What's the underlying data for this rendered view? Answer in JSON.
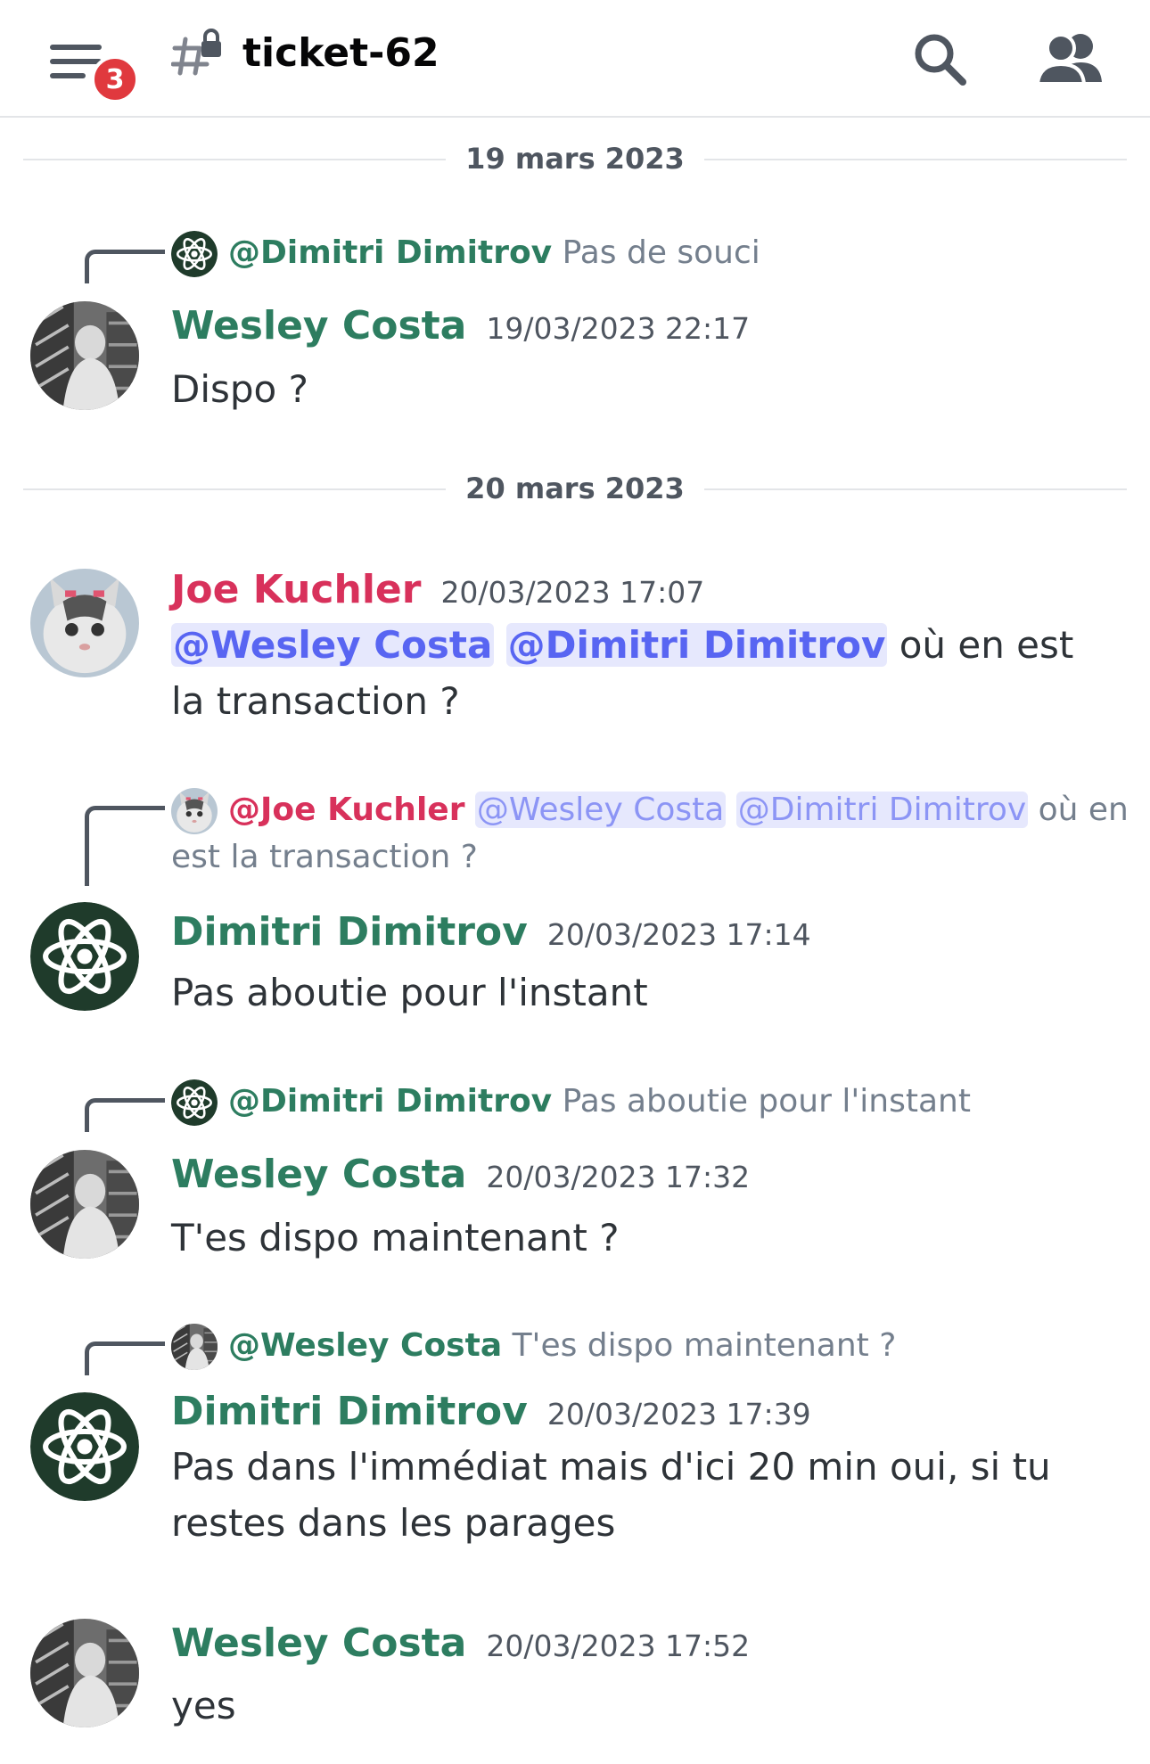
{
  "header": {
    "notification_count": "3",
    "channel_name": "ticket-62"
  },
  "colors": {
    "wesley": "#2d7d60",
    "dimitri": "#2d7d60",
    "joe": "#d8315b",
    "mention_bg": "#e6e8fd",
    "mention_text": "#5865f2",
    "badge": "#e0393e"
  },
  "dividers": [
    "19 mars 2023",
    "20 mars 2023"
  ],
  "messages": [
    {
      "reply": {
        "name": "@Dimitri Dimitrov",
        "text": "Pas de souci"
      },
      "author": "Wesley Costa",
      "timestamp": "19/03/2023 22:17",
      "text": "Dispo ?"
    },
    {
      "author": "Joe Kuchler",
      "timestamp": "20/03/2023 17:07",
      "mention1": "@Wesley Costa",
      "mention2": "@Dimitri Dimitrov",
      "text": "où en est la transaction ?"
    },
    {
      "reply": {
        "name": "@Joe Kuchler",
        "mention1": "@Wesley Costa",
        "mention2": "@Dimitri Dimitrov",
        "text": "où en est la transaction ?"
      },
      "author": "Dimitri Dimitrov",
      "timestamp": "20/03/2023 17:14",
      "text": "Pas aboutie pour l'instant"
    },
    {
      "reply": {
        "name": "@Dimitri Dimitrov",
        "text": "Pas aboutie pour l'instant"
      },
      "author": "Wesley Costa",
      "timestamp": "20/03/2023 17:32",
      "text": "T'es dispo maintenant ?"
    },
    {
      "reply": {
        "name": "@Wesley Costa",
        "text": "T'es dispo maintenant ?"
      },
      "author": "Dimitri Dimitrov",
      "timestamp": "20/03/2023 17:39",
      "text": "Pas dans l'immédiat mais d'ici 20 min oui, si tu restes dans les parages"
    },
    {
      "author": "Wesley Costa",
      "timestamp": "20/03/2023 17:52",
      "text": "yes"
    }
  ]
}
